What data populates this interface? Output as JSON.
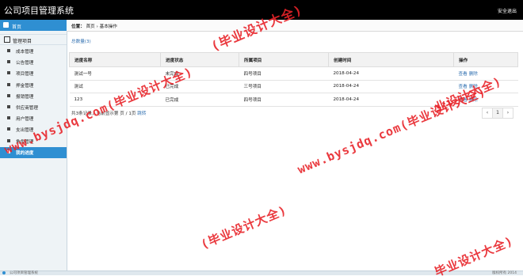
{
  "header": {
    "title": "公司项目管理系统",
    "logout": "安全退出"
  },
  "sidebar": {
    "home": "首页",
    "group": "管理项目",
    "items": [
      {
        "label": "成本管理"
      },
      {
        "label": "公告管理"
      },
      {
        "label": "项目管理"
      },
      {
        "label": "押金管理"
      },
      {
        "label": "报销管理"
      },
      {
        "label": "供应商管理"
      },
      {
        "label": "用户管理"
      },
      {
        "label": "支出管理"
      },
      {
        "label": "角色管理"
      },
      {
        "label": "我的进度",
        "active": true
      }
    ]
  },
  "breadcrumb": {
    "prefix": "位置：",
    "first": "首页",
    "sep": "›",
    "second": "基本操作"
  },
  "summary": {
    "count_link": "总数量(3)"
  },
  "table": {
    "headers": [
      "进度名称",
      "进度状态",
      "所属项目",
      "创建时间",
      "操作"
    ],
    "rows": [
      {
        "name": "测试一号",
        "status": "未完成",
        "project": "四号项目",
        "created": "2018-04-24",
        "view": "查看",
        "delete": "删除"
      },
      {
        "name": "测试",
        "status": "已完成",
        "project": "三号项目",
        "created": "2018-04-24",
        "view": "查看",
        "delete": "删除"
      },
      {
        "name": "123",
        "status": "已完成",
        "project": "四号项目",
        "created": "2018-04-24",
        "view": "查看",
        "delete": "删除"
      }
    ]
  },
  "pagination": {
    "summary": "共3条记录，当前显示第",
    "page_info": "页 / 1页",
    "jump": "跳转",
    "prev": "‹",
    "current": "1",
    "next": "›"
  },
  "footer": {
    "left": "公司项目管理系统",
    "right": "版权所有 2014"
  },
  "watermark": {
    "text": "www.bysjdq.com(毕业设计大全)",
    "part_a": "业设计大全)",
    "part_b": "毕业设计大全)",
    "part_c": "(毕业设计大全)",
    "color": "#e8242a"
  },
  "colors": {
    "accent": "#2f8fd2",
    "link": "#2f6fb0",
    "topbar": "#000000"
  }
}
